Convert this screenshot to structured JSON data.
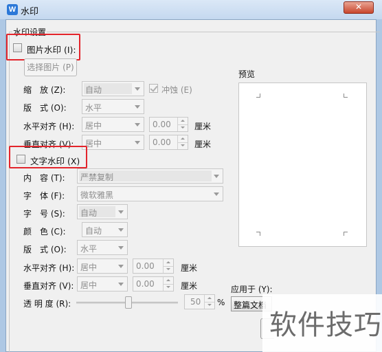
{
  "window": {
    "title": "水印",
    "close": "✕",
    "app_icon": "W"
  },
  "group_title": "水印设置",
  "picture": {
    "checkbox_label": "图片水印 (I):",
    "select_button": "选择图片 (P)",
    "scale_label": "缩　放 (Z):",
    "scale_value": "自动",
    "washout_label": "冲蚀 (E)",
    "layout_label": "版　式 (O):",
    "layout_value": "水平",
    "halign_label": "水平对齐 (H):",
    "halign_value": "居中",
    "halign_offset": "0.00",
    "halign_unit": "厘米",
    "valign_label": "垂直对齐 (V):",
    "valign_value": "居中",
    "valign_offset": "0.00",
    "valign_unit": "厘米"
  },
  "text": {
    "checkbox_label": "文字水印 (X)",
    "content_label": "内　容 (T):",
    "content_value": "严禁复制",
    "font_label": "字　体 (F):",
    "font_value": "微软雅黑",
    "size_label": "字　号 (S):",
    "size_value": "自动",
    "color_label": "颜　色 (C):",
    "color_value": "自动",
    "layout_label": "版　式 (O):",
    "layout_value": "水平",
    "halign_label": "水平对齐 (H):",
    "halign_value": "居中",
    "halign_offset": "0.00",
    "halign_unit": "厘米",
    "valign_label": "垂直对齐 (V):",
    "valign_value": "居中",
    "valign_offset": "0.00",
    "valign_unit": "厘米",
    "transparency_label": "透 明 度 (R):",
    "transparency_value": "50",
    "transparency_unit": "%",
    "transparency_level": 0.5
  },
  "preview_label": "预览",
  "apply_label": "应用于 (Y):",
  "apply_value": "整篇文档",
  "watermark_overlay": "软件技巧",
  "colors": {
    "highlight": "#e3242b",
    "title_bg": "#c4d8ef",
    "dialog_bg": "#f0f0f0"
  }
}
